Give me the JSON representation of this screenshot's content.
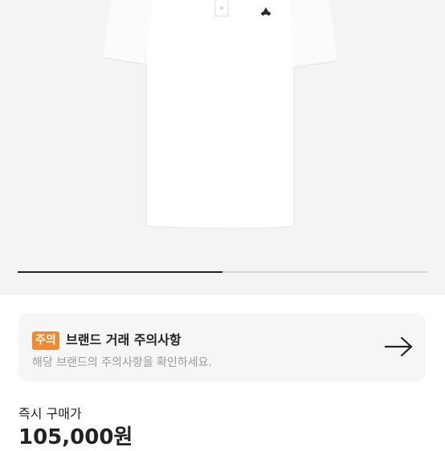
{
  "product": {
    "image_alt": "white polo shirt",
    "gallery_progress": 0.5
  },
  "notice": {
    "badge": "주의",
    "title": "브랜드 거래 주의사항",
    "description": "해당 브랜드의 주의사항을 확인하세요.",
    "arrow_icon": "arrow-right-icon",
    "badge_color": "#f08a2c"
  },
  "price": {
    "label": "즉시 구매가",
    "value": "105,000원"
  }
}
